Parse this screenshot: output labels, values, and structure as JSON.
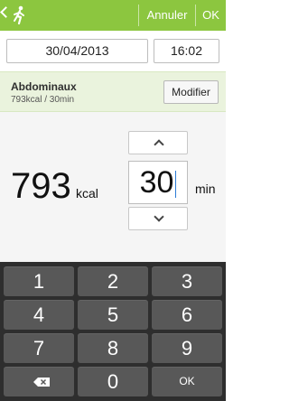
{
  "actionbar": {
    "back_icon": "back-chevron-icon",
    "app_icon": "runner-icon",
    "cancel_label": "Annuler",
    "ok_label": "OK",
    "background": "#8cc63f"
  },
  "datetime": {
    "date": "30/04/2013",
    "time": "16:02"
  },
  "exercise": {
    "name": "Abdominaux",
    "details": "793kcal / 30min",
    "modify_label": "Modifier"
  },
  "picker": {
    "kcal_value": "793",
    "kcal_unit": "kcal",
    "minutes_value": "30",
    "minutes_unit": "min",
    "up_icon": "chevron-up-icon",
    "down_icon": "chevron-down-icon"
  },
  "keyboard": {
    "keys": [
      "1",
      "2",
      "3",
      "4",
      "5",
      "6",
      "7",
      "8",
      "9",
      "",
      "0",
      "OK"
    ],
    "backspace_icon": "backspace-icon",
    "background": "#2e2e2e",
    "key_color": "#585858"
  }
}
